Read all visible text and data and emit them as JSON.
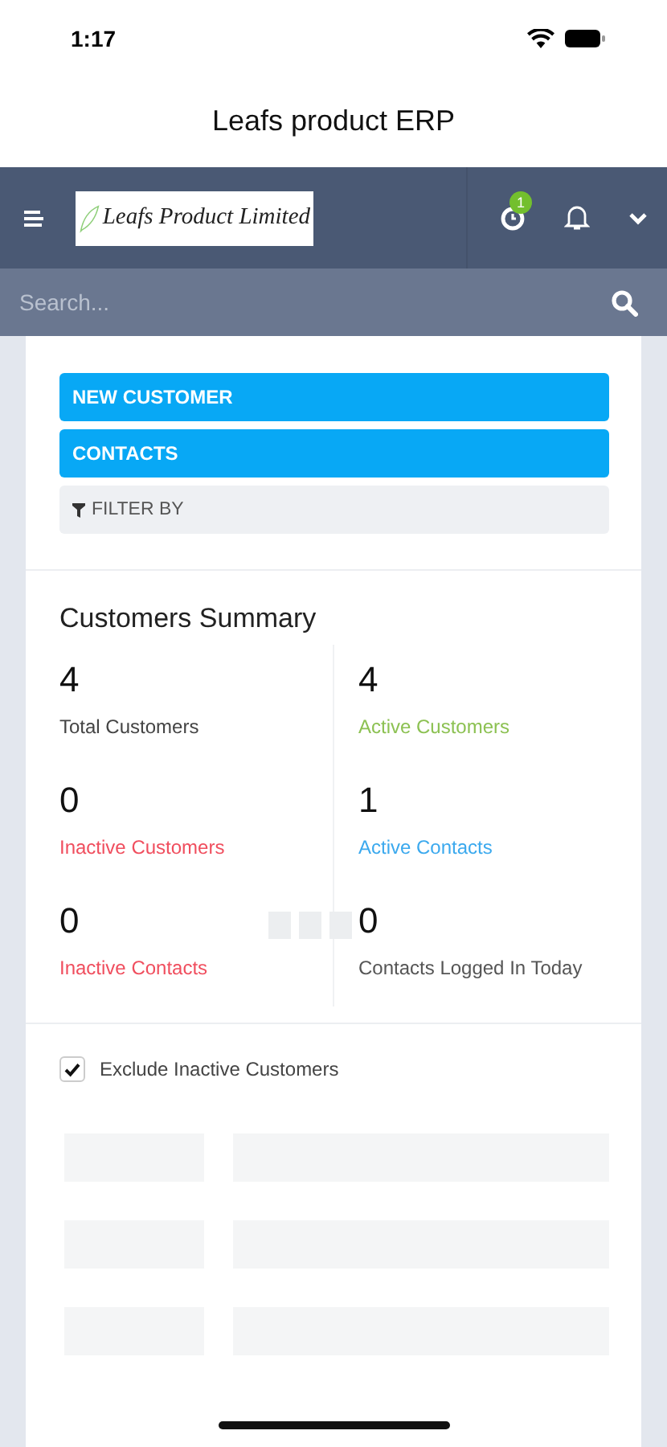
{
  "status_bar": {
    "time": "1:17"
  },
  "app_title": "Leafs product ERP",
  "navbar": {
    "logo_text": "Leafs Product Limited",
    "timer_badge": "1"
  },
  "search": {
    "placeholder": "Search..."
  },
  "actions": [
    {
      "label": "NEW CUSTOMER",
      "kind": "primary"
    },
    {
      "label": "CONTACTS",
      "kind": "primary"
    },
    {
      "label": "FILTER BY",
      "kind": "filter"
    }
  ],
  "summary": {
    "title": "Customers Summary",
    "stats": [
      {
        "value": "4",
        "label": "Total Customers",
        "color": "#444444"
      },
      {
        "value": "4",
        "label": "Active Customers",
        "color": "#8cc152"
      },
      {
        "value": "0",
        "label": "Inactive Customers",
        "color": "#f04e5e"
      },
      {
        "value": "1",
        "label": "Active Contacts",
        "color": "#3ba9ee"
      },
      {
        "value": "0",
        "label": "Inactive Contacts",
        "color": "#f04e5e"
      },
      {
        "value": "0",
        "label": "Contacts Logged In Today",
        "color": "#555555"
      }
    ]
  },
  "exclude_inactive": {
    "label": "Exclude Inactive Customers",
    "checked": true
  },
  "loading": true
}
